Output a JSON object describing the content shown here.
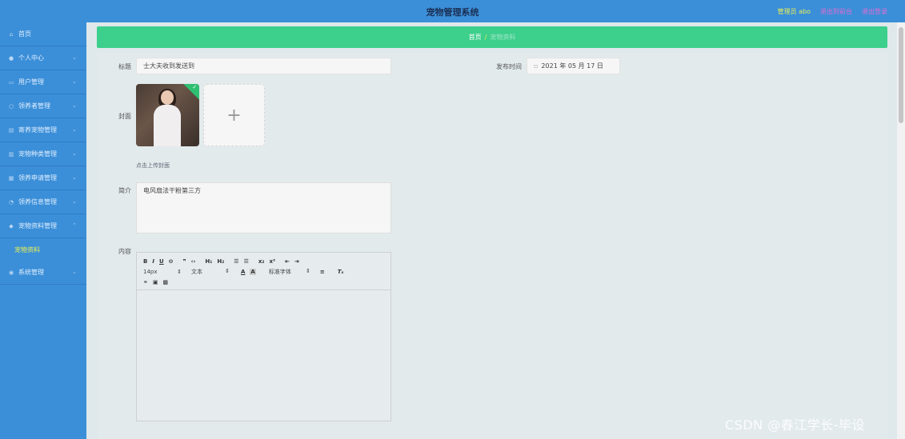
{
  "header": {
    "title": "宠物管理系统",
    "admin": "管理员 abo",
    "exit_to_front": "退出到前台",
    "logout": "退出登录"
  },
  "sidebar": {
    "items": [
      {
        "label": "首页",
        "icon": "home-icon"
      },
      {
        "label": "个人中心",
        "icon": "user-icon"
      },
      {
        "label": "用户管理",
        "icon": "users-icon"
      },
      {
        "label": "领养者管理",
        "icon": "adopter-icon"
      },
      {
        "label": "寄养宠物管理",
        "icon": "pet-icon"
      },
      {
        "label": "宠物种类管理",
        "icon": "category-icon"
      },
      {
        "label": "领养申请管理",
        "icon": "apply-icon"
      },
      {
        "label": "领养信息管理",
        "icon": "info-icon"
      },
      {
        "label": "宠物资料管理",
        "icon": "data-icon"
      }
    ],
    "active_sub": "宠物资料",
    "system": {
      "label": "系统管理",
      "icon": "settings-icon"
    }
  },
  "breadcrumb": {
    "home": "首页",
    "separator": "/",
    "current": "宠物资料"
  },
  "form": {
    "title_label": "标题",
    "title_value": "士大夫收到发送到",
    "publish_label": "发布时间",
    "publish_value": "2021 年 05 月 17 日",
    "cover_label": "封面",
    "cover_hint": "点击上传封面",
    "intro_label": "简介",
    "intro_value": "电风扇法干粉第三方",
    "content_label": "内容"
  },
  "editor": {
    "font_size": "14px",
    "paragraph": "文本",
    "font_family": "标准字体"
  },
  "watermark": "CSDN @春江学长-毕设",
  "colors": {
    "header_blue": "#3b8fd8",
    "crumb_green": "#3dcf8c",
    "accent_yellow": "#e8ef57",
    "link_pink": "#e66bd4"
  }
}
